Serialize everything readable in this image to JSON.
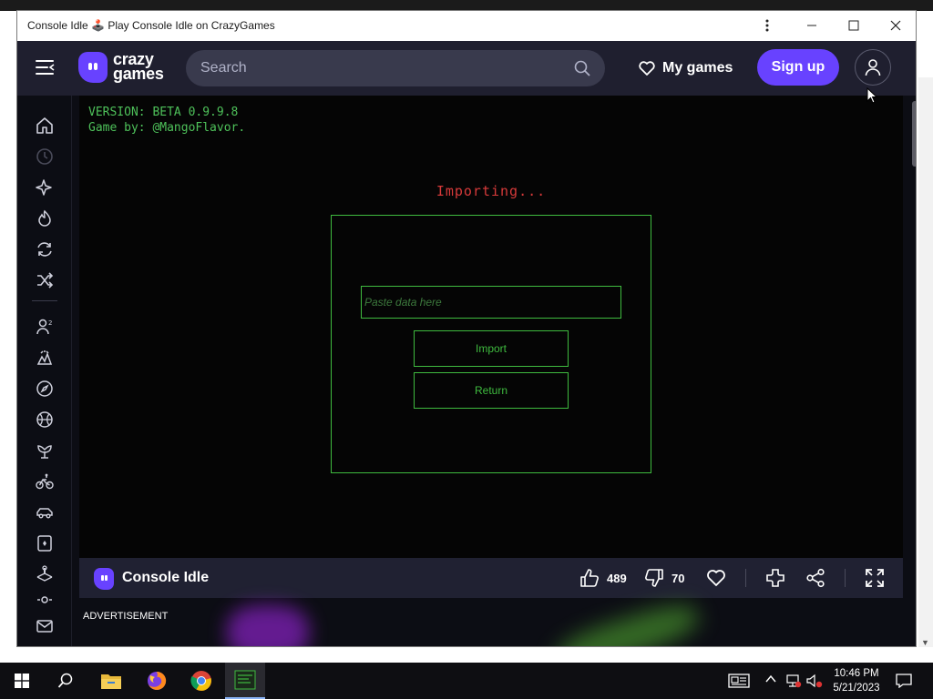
{
  "window": {
    "title": "Console Idle 🕹️ Play Console Idle on CrazyGames",
    "controls": [
      "menu-icon",
      "minimize-icon",
      "maximize-icon",
      "close-icon"
    ]
  },
  "header": {
    "logo_line1": "crazy",
    "logo_line2": "games",
    "search_placeholder": "Search",
    "my_games": "My games",
    "sign_up": "Sign up",
    "brand_color": "#6842ff"
  },
  "sidebar": {
    "icons": [
      "home-icon",
      "recent-icon",
      "new-icon",
      "trending-icon",
      "updated-icon",
      "random-icon",
      "multiplayer-icon",
      "action-icon",
      "adventure-icon",
      "basketball-icon",
      "casual-icon",
      "bike-icon",
      "car-icon",
      "card-icon",
      "clicker-icon",
      "more-icon",
      "mail-icon"
    ]
  },
  "game": {
    "version_line": "VERSION: BETA 0.9.9.8",
    "author_line": "Game by: @MangoFlavor.",
    "status": "Importing...",
    "paste_placeholder": "Paste data here",
    "import_label": "Import",
    "return_label": "Return",
    "accent_color": "#3fbb3f"
  },
  "gamebar": {
    "title": "Console Idle",
    "likes": "489",
    "dislikes": "70"
  },
  "ad": {
    "label": "ADVERTISEMENT"
  },
  "taskbar": {
    "time": "10:46 PM",
    "date": "5/21/2023"
  }
}
